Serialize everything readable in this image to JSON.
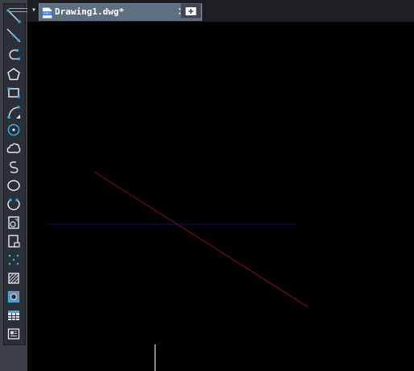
{
  "tab_bar": {
    "menu_glyph": "▾",
    "active_tab": {
      "icon": "dwg-file-icon",
      "icon_text": "DWG",
      "title": "Drawing1.dwg*",
      "close_glyph": "✕"
    },
    "new_tab_icon": "new-tab-icon"
  },
  "toolbar": {
    "tools": [
      "line-icon",
      "construction-line-icon",
      "polyline-icon",
      "polygon-icon",
      "rectangle-icon",
      "arc-icon",
      "circle-icon",
      "revision-cloud-icon",
      "spline-icon",
      "ellipse-icon",
      "ellipse-arc-icon",
      "insert-block-icon",
      "make-block-icon",
      "point-icon",
      "hatch-icon",
      "region-icon",
      "table-icon",
      "multiline-text-icon"
    ]
  },
  "canvas": {
    "background": "#000000",
    "entities": [
      {
        "type": "line",
        "color": "#8b0f12"
      },
      {
        "type": "line",
        "color": "#0d0d8a"
      }
    ],
    "cursor_color": "#ffffff"
  },
  "colors": {
    "toolbar_bg": "#3b3f48",
    "tab_active_bg": "#5f6f82",
    "icon_accent": "#3bb0e6"
  }
}
